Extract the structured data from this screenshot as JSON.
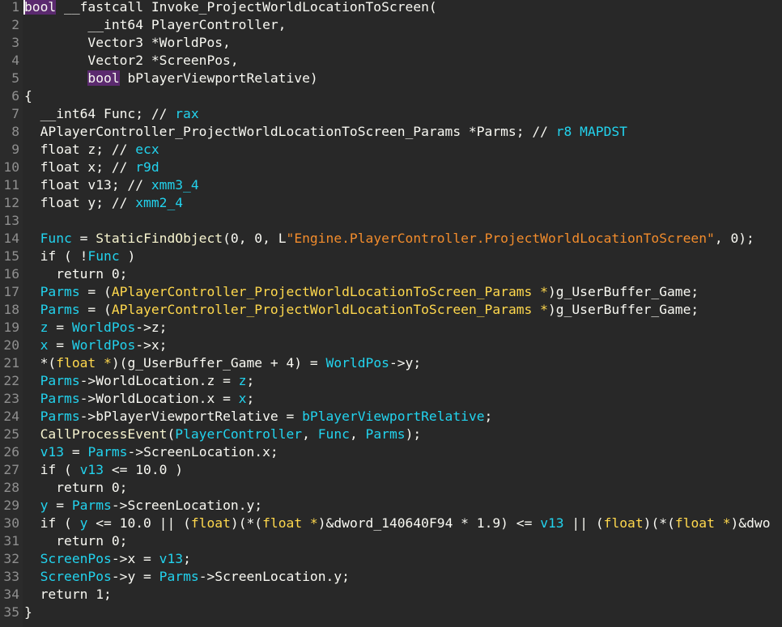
{
  "editor": {
    "lines": [
      {
        "n": "1",
        "tokens": [
          {
            "t": "bool",
            "c": "hl-kw"
          },
          {
            "t": " __fastcall Invoke_ProjectWorldLocationToScreen(",
            "c": "id"
          }
        ]
      },
      {
        "n": "2",
        "tokens": [
          {
            "t": "        __int64 PlayerController,",
            "c": "id"
          }
        ]
      },
      {
        "n": "3",
        "tokens": [
          {
            "t": "        Vector3 *WorldPos,",
            "c": "id"
          }
        ]
      },
      {
        "n": "4",
        "tokens": [
          {
            "t": "        Vector2 *ScreenPos,",
            "c": "id"
          }
        ]
      },
      {
        "n": "5",
        "tokens": [
          {
            "t": "        ",
            "c": "id"
          },
          {
            "t": "bool",
            "c": "hl-kw"
          },
          {
            "t": " bPlayerViewportRelative)",
            "c": "id"
          }
        ]
      },
      {
        "n": "6",
        "tokens": [
          {
            "t": "{",
            "c": "id"
          }
        ]
      },
      {
        "n": "7",
        "tokens": [
          {
            "t": "  __int64 Func; // ",
            "c": "id"
          },
          {
            "t": "rax",
            "c": "reg"
          }
        ]
      },
      {
        "n": "8",
        "tokens": [
          {
            "t": "  APlayerController_ProjectWorldLocationToScreen_Params *Parms; // ",
            "c": "id"
          },
          {
            "t": "r8 MAPDST",
            "c": "reg"
          }
        ]
      },
      {
        "n": "9",
        "tokens": [
          {
            "t": "  float z; // ",
            "c": "id"
          },
          {
            "t": "ecx",
            "c": "reg"
          }
        ]
      },
      {
        "n": "10",
        "tokens": [
          {
            "t": "  float x; // ",
            "c": "id"
          },
          {
            "t": "r9d",
            "c": "reg"
          }
        ]
      },
      {
        "n": "11",
        "tokens": [
          {
            "t": "  float v13; // ",
            "c": "id"
          },
          {
            "t": "xmm3_4",
            "c": "reg"
          }
        ]
      },
      {
        "n": "12",
        "tokens": [
          {
            "t": "  float y; // ",
            "c": "id"
          },
          {
            "t": "xmm2_4",
            "c": "reg"
          }
        ]
      },
      {
        "n": "13",
        "tokens": []
      },
      {
        "n": "14",
        "tokens": [
          {
            "t": "  ",
            "c": "id"
          },
          {
            "t": "Func",
            "c": "var"
          },
          {
            "t": " = ",
            "c": "id"
          },
          {
            "t": "StaticFindObject",
            "c": "func"
          },
          {
            "t": "(0, 0, L",
            "c": "id"
          },
          {
            "t": "\"Engine.PlayerController.ProjectWorldLocationToScreen\"",
            "c": "str"
          },
          {
            "t": ", 0);",
            "c": "id"
          }
        ]
      },
      {
        "n": "15",
        "tokens": [
          {
            "t": "  if ( !",
            "c": "id"
          },
          {
            "t": "Func",
            "c": "var"
          },
          {
            "t": " )",
            "c": "id"
          }
        ]
      },
      {
        "n": "16",
        "tokens": [
          {
            "t": "    return 0;",
            "c": "id"
          }
        ]
      },
      {
        "n": "17",
        "tokens": [
          {
            "t": "  ",
            "c": "id"
          },
          {
            "t": "Parms",
            "c": "var"
          },
          {
            "t": " = (",
            "c": "id"
          },
          {
            "t": "APlayerController_ProjectWorldLocationToScreen_Params *",
            "c": "hl"
          },
          {
            "t": ")g_UserBuffer_Game;",
            "c": "id"
          }
        ]
      },
      {
        "n": "18",
        "tokens": [
          {
            "t": "  ",
            "c": "id"
          },
          {
            "t": "Parms",
            "c": "var"
          },
          {
            "t": " = (",
            "c": "id"
          },
          {
            "t": "APlayerController_ProjectWorldLocationToScreen_Params *",
            "c": "hl"
          },
          {
            "t": ")g_UserBuffer_Game;",
            "c": "id"
          }
        ]
      },
      {
        "n": "19",
        "tokens": [
          {
            "t": "  ",
            "c": "id"
          },
          {
            "t": "z",
            "c": "var"
          },
          {
            "t": " = ",
            "c": "id"
          },
          {
            "t": "WorldPos",
            "c": "var"
          },
          {
            "t": "->z;",
            "c": "id"
          }
        ]
      },
      {
        "n": "20",
        "tokens": [
          {
            "t": "  ",
            "c": "id"
          },
          {
            "t": "x",
            "c": "var"
          },
          {
            "t": " = ",
            "c": "id"
          },
          {
            "t": "WorldPos",
            "c": "var"
          },
          {
            "t": "->x;",
            "c": "id"
          }
        ]
      },
      {
        "n": "21",
        "tokens": [
          {
            "t": "  *(",
            "c": "id"
          },
          {
            "t": "float *",
            "c": "hl"
          },
          {
            "t": ")(g_UserBuffer_Game + 4) = ",
            "c": "id"
          },
          {
            "t": "WorldPos",
            "c": "var"
          },
          {
            "t": "->y;",
            "c": "id"
          }
        ]
      },
      {
        "n": "22",
        "tokens": [
          {
            "t": "  ",
            "c": "id"
          },
          {
            "t": "Parms",
            "c": "var"
          },
          {
            "t": "->WorldLocation.z = ",
            "c": "id"
          },
          {
            "t": "z",
            "c": "var"
          },
          {
            "t": ";",
            "c": "id"
          }
        ]
      },
      {
        "n": "23",
        "tokens": [
          {
            "t": "  ",
            "c": "id"
          },
          {
            "t": "Parms",
            "c": "var"
          },
          {
            "t": "->WorldLocation.x = ",
            "c": "id"
          },
          {
            "t": "x",
            "c": "var"
          },
          {
            "t": ";",
            "c": "id"
          }
        ]
      },
      {
        "n": "24",
        "tokens": [
          {
            "t": "  ",
            "c": "id"
          },
          {
            "t": "Parms",
            "c": "var"
          },
          {
            "t": "->bPlayerViewportRelative = ",
            "c": "id"
          },
          {
            "t": "bPlayerViewportRelative",
            "c": "var"
          },
          {
            "t": ";",
            "c": "id"
          }
        ]
      },
      {
        "n": "25",
        "tokens": [
          {
            "t": "  ",
            "c": "id"
          },
          {
            "t": "CallProcessEvent",
            "c": "func"
          },
          {
            "t": "(",
            "c": "id"
          },
          {
            "t": "PlayerController",
            "c": "var"
          },
          {
            "t": ", ",
            "c": "id"
          },
          {
            "t": "Func",
            "c": "var"
          },
          {
            "t": ", ",
            "c": "id"
          },
          {
            "t": "Parms",
            "c": "var"
          },
          {
            "t": ");",
            "c": "id"
          }
        ]
      },
      {
        "n": "26",
        "tokens": [
          {
            "t": "  ",
            "c": "id"
          },
          {
            "t": "v13",
            "c": "var"
          },
          {
            "t": " = ",
            "c": "id"
          },
          {
            "t": "Parms",
            "c": "var"
          },
          {
            "t": "->ScreenLocation.x;",
            "c": "id"
          }
        ]
      },
      {
        "n": "27",
        "tokens": [
          {
            "t": "  if ( ",
            "c": "id"
          },
          {
            "t": "v13",
            "c": "var"
          },
          {
            "t": " <= 10.0 )",
            "c": "id"
          }
        ]
      },
      {
        "n": "28",
        "tokens": [
          {
            "t": "    return 0;",
            "c": "id"
          }
        ]
      },
      {
        "n": "29",
        "tokens": [
          {
            "t": "  ",
            "c": "id"
          },
          {
            "t": "y",
            "c": "var"
          },
          {
            "t": " = ",
            "c": "id"
          },
          {
            "t": "Parms",
            "c": "var"
          },
          {
            "t": "->ScreenLocation.y;",
            "c": "id"
          }
        ]
      },
      {
        "n": "30",
        "tokens": [
          {
            "t": "  if ( ",
            "c": "id"
          },
          {
            "t": "y",
            "c": "var"
          },
          {
            "t": " <= 10.0 || (",
            "c": "id"
          },
          {
            "t": "float",
            "c": "hl"
          },
          {
            "t": ")(*(",
            "c": "id"
          },
          {
            "t": "float *",
            "c": "hl"
          },
          {
            "t": ")&dword_140640F94 * 1.9) <= ",
            "c": "id"
          },
          {
            "t": "v13",
            "c": "var"
          },
          {
            "t": " || (",
            "c": "id"
          },
          {
            "t": "float",
            "c": "hl"
          },
          {
            "t": ")(*(",
            "c": "id"
          },
          {
            "t": "float *",
            "c": "hl"
          },
          {
            "t": ")&dwo",
            "c": "id"
          }
        ]
      },
      {
        "n": "31",
        "tokens": [
          {
            "t": "    return 0;",
            "c": "id"
          }
        ]
      },
      {
        "n": "32",
        "tokens": [
          {
            "t": "  ",
            "c": "id"
          },
          {
            "t": "ScreenPos",
            "c": "var"
          },
          {
            "t": "->x = ",
            "c": "id"
          },
          {
            "t": "v13",
            "c": "var"
          },
          {
            "t": ";",
            "c": "id"
          }
        ]
      },
      {
        "n": "33",
        "tokens": [
          {
            "t": "  ",
            "c": "id"
          },
          {
            "t": "ScreenPos",
            "c": "var"
          },
          {
            "t": "->y = ",
            "c": "id"
          },
          {
            "t": "Parms",
            "c": "var"
          },
          {
            "t": "->ScreenLocation.y;",
            "c": "id"
          }
        ]
      },
      {
        "n": "34",
        "tokens": [
          {
            "t": "  return 1;",
            "c": "id"
          }
        ]
      },
      {
        "n": "35",
        "tokens": [
          {
            "t": "}",
            "c": "id"
          }
        ]
      }
    ]
  },
  "colors": {
    "background": "#282828",
    "default_text": "#f8f8f2",
    "variable": "#22d3ee",
    "type_highlight": "#ffd84d",
    "string": "#f28c2c",
    "keyword_highlight_bg": "#5b2a6f",
    "line_number": "#8f8f8f"
  }
}
